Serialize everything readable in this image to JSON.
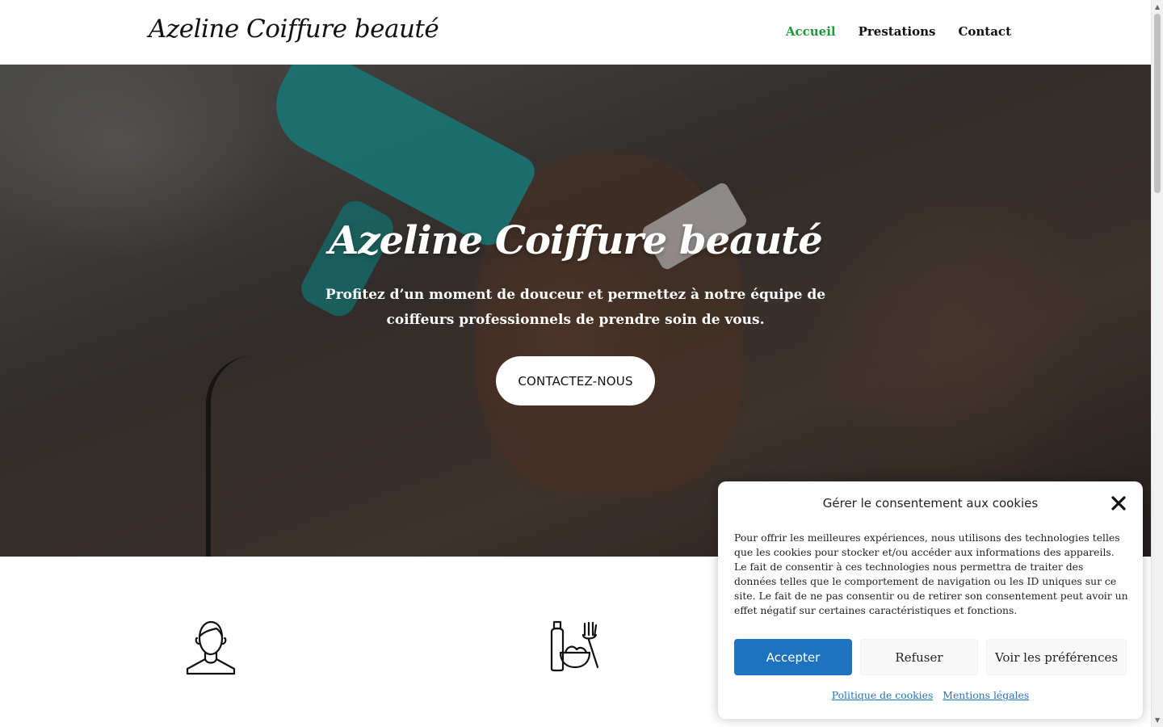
{
  "header": {
    "logo": "Azeline Coiffure beauté",
    "nav": [
      {
        "label": "Accueil",
        "active": true
      },
      {
        "label": "Prestations",
        "active": false
      },
      {
        "label": "Contact",
        "active": false
      }
    ]
  },
  "hero": {
    "title": "Azeline Coiffure beauté",
    "subtitle": "Profitez d’un moment de douceur et permettez à notre équipe de coiffeurs professionnels de prendre soin de vous.",
    "cta": "CONTACTEZ-NOUS"
  },
  "services": [
    {
      "icon": "person-icon"
    },
    {
      "icon": "hair-products-icon"
    }
  ],
  "cookie_modal": {
    "title": "Gérer le consentement aux cookies",
    "text": "Pour offrir les meilleures expériences, nous utilisons des technologies telles que les cookies pour stocker et/ou accéder aux informations des appareils. Le fait de consentir à ces technologies nous permettra de traiter des données telles que le comportement de navigation ou les ID uniques sur ce site. Le fait de ne pas consentir ou de retirer son consentement peut avoir un effet négatif sur certaines caractéristiques et fonctions.",
    "accept": "Accepter",
    "refuse": "Refuser",
    "preferences": "Voir les préférences",
    "links": [
      "Politique de cookies",
      "Mentions légales"
    ]
  },
  "colors": {
    "accent_nav": "#1e9a3a",
    "accept_button": "#1e73be",
    "link": "#1e73be"
  }
}
